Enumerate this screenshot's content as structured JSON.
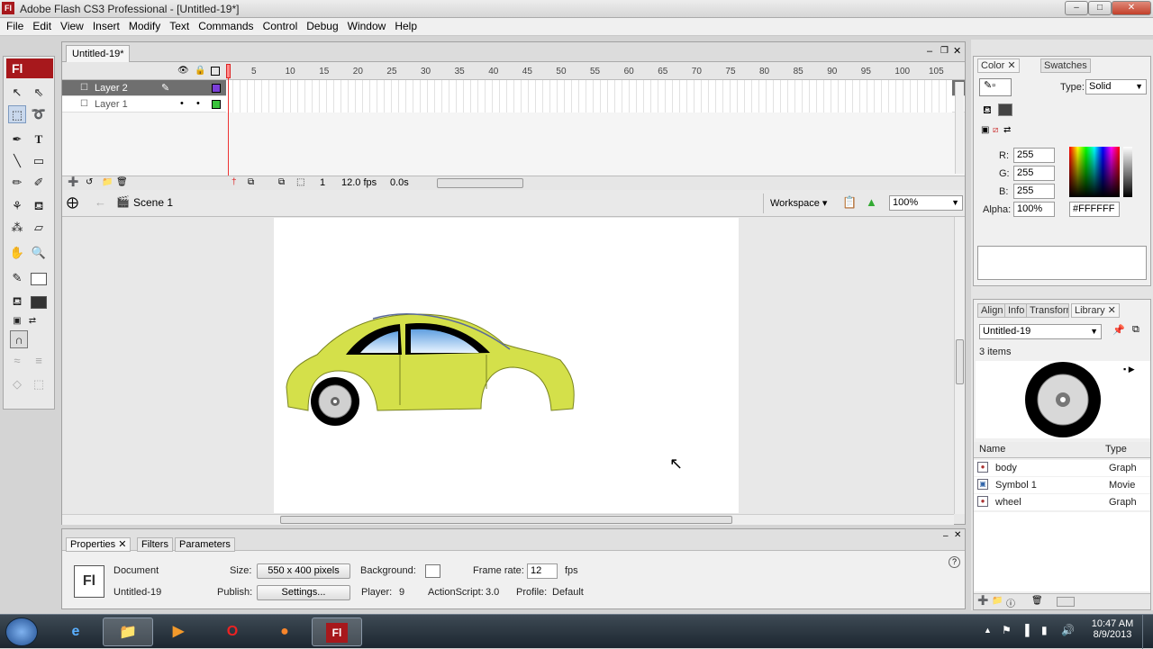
{
  "window": {
    "title": "Adobe Flash CS3 Professional - [Untitled-19*]",
    "app_icon": "Fl",
    "min": "–",
    "max": "□",
    "close": "✕"
  },
  "menu": [
    "File",
    "Edit",
    "View",
    "Insert",
    "Modify",
    "Text",
    "Commands",
    "Control",
    "Debug",
    "Window",
    "Help"
  ],
  "tools": {
    "logo": "Fl"
  },
  "document": {
    "tab": "Untitled-19*",
    "layers": [
      {
        "name": "Layer 2",
        "color": "#7b3fd8"
      },
      {
        "name": "Layer 1",
        "color": "#39c23b"
      }
    ],
    "frame_numbers": [
      "5",
      "10",
      "15",
      "20",
      "25",
      "30",
      "35",
      "40",
      "45",
      "50",
      "55",
      "60",
      "65",
      "70",
      "75",
      "80",
      "85",
      "90",
      "95",
      "100",
      "105"
    ],
    "frame": "1",
    "fps": "12.0 fps",
    "time": "0.0s",
    "scene": "Scene 1",
    "workspace": "Workspace",
    "zoom": "100%"
  },
  "properties": {
    "tabs": [
      "Properties",
      "Filters",
      "Parameters"
    ],
    "logo": "Fl",
    "doc_label": "Document",
    "doc_name": "Untitled-19",
    "size_label": "Size:",
    "size_value": "550 x 400 pixels",
    "publish_label": "Publish:",
    "settings_button": "Settings...",
    "background_label": "Background:",
    "framerate_label": "Frame rate:",
    "framerate_value": "12",
    "fps_label": "fps",
    "player_label": "Player:",
    "player_value": "9",
    "actionscript_label": "ActionScript:",
    "actionscript_value": "3.0",
    "profile_label": "Profile:",
    "profile_value": "Default"
  },
  "color_panel": {
    "tabs": [
      "Color",
      "Swatches"
    ],
    "type_label": "Type:",
    "type_value": "Solid",
    "r_label": "R:",
    "r": "255",
    "g_label": "G:",
    "g": "255",
    "b_label": "B:",
    "b": "255",
    "alpha_label": "Alpha:",
    "alpha": "100%",
    "hex": "#FFFFFF"
  },
  "library_panel": {
    "tabs": [
      "Align",
      "Info",
      "Transform",
      "Library"
    ],
    "document": "Untitled-19",
    "count": "3 items",
    "col_name": "Name",
    "col_type": "Type",
    "items": [
      {
        "name": "body",
        "type": "Graph"
      },
      {
        "name": "Symbol 1",
        "type": "Movie"
      },
      {
        "name": "wheel",
        "type": "Graph"
      }
    ]
  },
  "taskbar": {
    "time": "10:47 AM",
    "date": "8/9/2013",
    "flash_label": "Fl"
  },
  "colors": {
    "flash_red": "#a7181c",
    "car_body": "#d4e04a",
    "window_blue": "#8cc4ee"
  }
}
